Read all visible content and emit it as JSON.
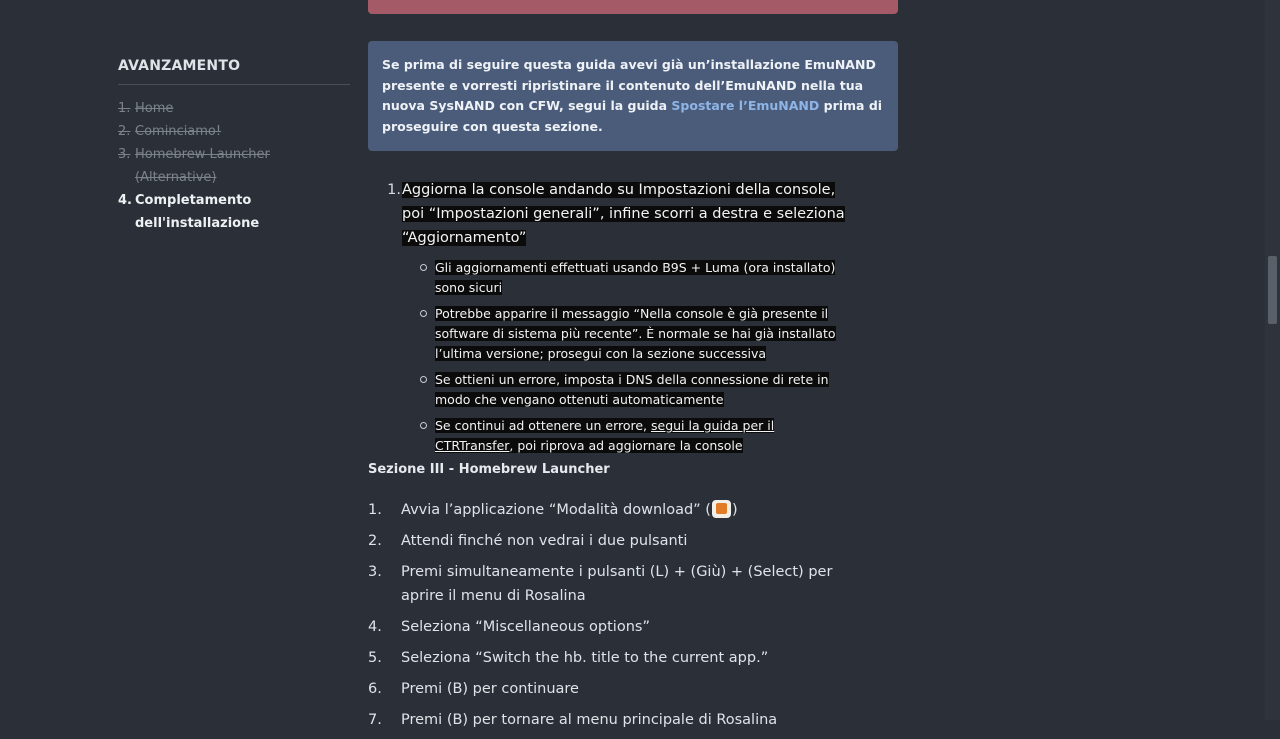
{
  "sidebar": {
    "title": "AVANZAMENTO",
    "items": [
      {
        "num": "1.",
        "label": "Home"
      },
      {
        "num": "2.",
        "label": "Cominciamo!"
      },
      {
        "num": "3.",
        "label": "Homebrew Launcher (Alternative)"
      },
      {
        "num": "4.",
        "label": "Completamento dell'installazione"
      }
    ]
  },
  "info_box": {
    "text_before": "Se prima di seguire questa guida avevi già un’installazione EmuNAND presente e vorresti ripristinare il contenuto dell’EmuNAND nella tua nuova SysNAND con CFW, segui la guida ",
    "link": "Spostare l’EmuNAND",
    "text_after": " prima di proseguire con questa sezione."
  },
  "update_step": {
    "num": "1.",
    "text": "Aggiorna la console andando su Impostazioni della console, poi “Impostazioni generali”, infine scorri a destra e seleziona “Aggiornamento”",
    "notes": [
      "Gli aggiornamenti effettuati usando B9S + Luma (ora installato) sono sicuri",
      "Potrebbe apparire il messaggio “Nella console è già presente il software di sistema più recente”. È normale se hai già installato l’ultima versione; prosegui con la sezione successiva",
      "Se ottieni un errore, imposta i DNS della connessione di rete in modo che vengano ottenuti automaticamente"
    ],
    "last_note_before": "Se continui ad ottenere un errore, ",
    "last_note_link": "segui la guida per il CTRTransfer",
    "last_note_after": ", poi riprova ad aggiornare la console"
  },
  "section3": {
    "heading": "Sezione III - Homebrew Launcher",
    "step1_before": "Avvia l’applicazione “Modalità download” (",
    "step1_after": ")",
    "icon": "download-play-icon",
    "steps": [
      {
        "num": "1."
      },
      {
        "num": "2.",
        "text": "Attendi finché non vedrai i due pulsanti"
      },
      {
        "num": "3.",
        "text": "Premi simultaneamente i pulsanti (L) + (Giù) + (Select) per aprire il menu di Rosalina"
      },
      {
        "num": "4.",
        "text": "Seleziona “Miscellaneous options”"
      },
      {
        "num": "5.",
        "text": "Seleziona “Switch the hb. title to the current app.”"
      },
      {
        "num": "6.",
        "text": "Premi (B) per continuare"
      },
      {
        "num": "7.",
        "text": "Premi (B) per tornare al menu principale di Rosalina"
      }
    ]
  },
  "colors": {
    "background": "#2b3038",
    "info_box": "#4a5c7a",
    "alert": "#a55b67",
    "link": "#8fb4e6"
  }
}
